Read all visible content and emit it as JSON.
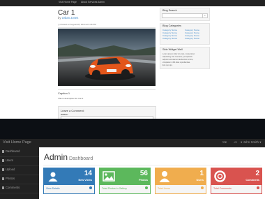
{
  "blog": {
    "brand": "Visit Home Page",
    "nav": [
      "About",
      "Services",
      "Admin"
    ],
    "post": {
      "title": "Car 1",
      "by_prefix": "by",
      "author": "Urban Jones",
      "posted": "Posted on August 28, 2014 at 9:36 PM",
      "caption": "Caption 1",
      "description": "This is description for Car 1"
    },
    "comment": {
      "title": "Leave a Comment:",
      "author_label": "Author:"
    },
    "sidebar": {
      "search_title": "Blog Search",
      "categories_title": "Blog Categories",
      "categories": [
        "Category Name",
        "Category Name",
        "Category Name",
        "Category Name",
        "Category Name",
        "Category Name",
        "Category Name",
        "Category Name"
      ],
      "widget_title": "Side Widget Well",
      "widget_lines": [
        "Lorem ipsum dolor sit amet, consectetur",
        "adipisicing elit. Inventore, perspiciatis",
        "adipisci accusamus laudantium errore,",
        "voluptatum nihil alias repudiandae.",
        "Eos quo qui."
      ]
    }
  },
  "admin": {
    "brand": "Visit Home Page",
    "user": "▾ John Smith ▾",
    "sidebar": [
      {
        "label": "Dashboard"
      },
      {
        "label": "Users"
      },
      {
        "label": "Upload"
      },
      {
        "label": "Photos"
      },
      {
        "label": "Comments"
      }
    ],
    "title": "Admin",
    "subtitle": "Dashboard",
    "cards": [
      {
        "count": "14",
        "caption": "New Views",
        "link": "View Details",
        "icon": "users-icon",
        "color": "#337ab7"
      },
      {
        "count": "56",
        "caption": "Photos",
        "link": "Total Photos in Gallery",
        "icon": "photo-icon",
        "color": "#5cb85c"
      },
      {
        "count": "1",
        "caption": "Users",
        "link": "Total Users",
        "icon": "user-icon",
        "color": "#f0ad4e"
      },
      {
        "count": "2",
        "caption": "Comments",
        "link": "Total Comments",
        "icon": "support-icon",
        "color": "#d9534f"
      }
    ]
  }
}
